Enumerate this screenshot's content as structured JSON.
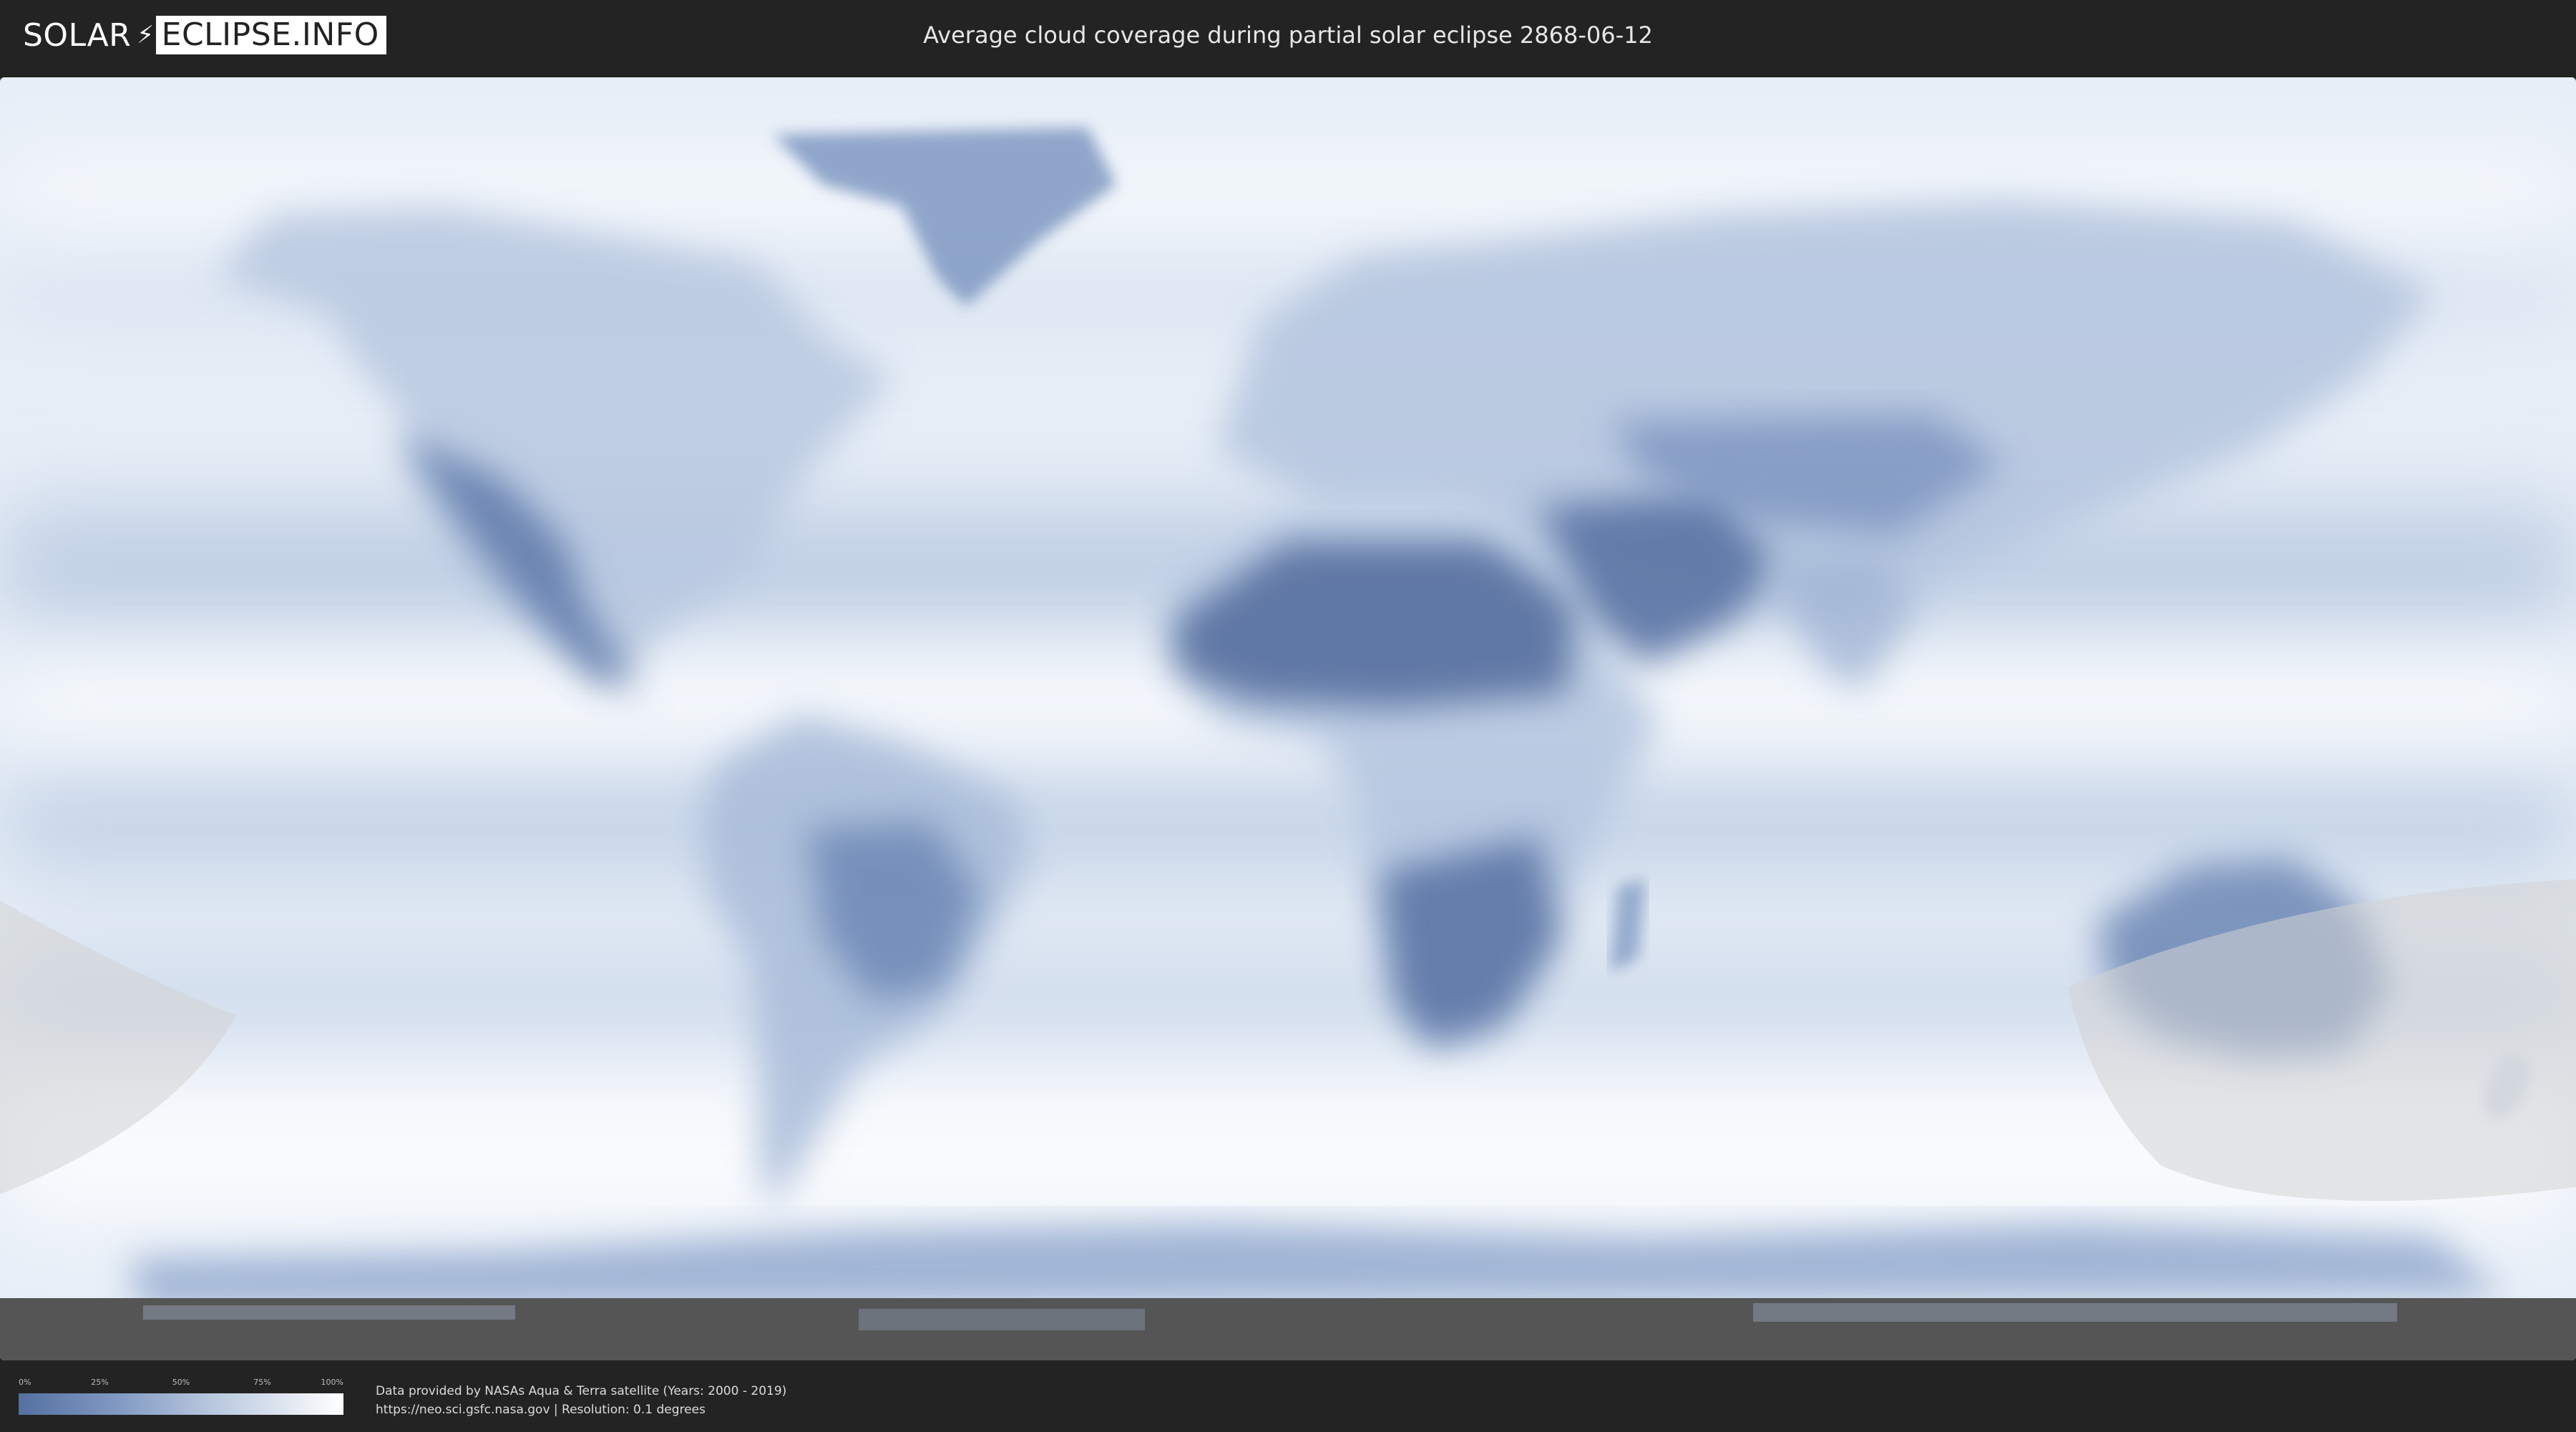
{
  "header": {
    "logo_left": "SOLAR",
    "logo_right": "ECLIPSE.INFO",
    "title": "Average cloud coverage during partial solar eclipse 2868-06-12"
  },
  "legend": {
    "ticks": [
      "0%",
      "25%",
      "50%",
      "75%",
      "100%"
    ],
    "colors": {
      "low": "#5470a1",
      "mid": "#8099c2",
      "high": "#ffffff"
    }
  },
  "credits": {
    "line1": "Data provided by NASAs Aqua & Terra satellite (Years: 2000 - 2019)",
    "line2": "https://neo.sci.gsfc.nasa.gov | Resolution: 0.1 degrees"
  },
  "map": {
    "colors": {
      "clear_sky": "#5b77a6",
      "cloud": "#ffffff",
      "eclipse_shadow": "#d3d3d3",
      "bottom_band": "#555555"
    }
  }
}
